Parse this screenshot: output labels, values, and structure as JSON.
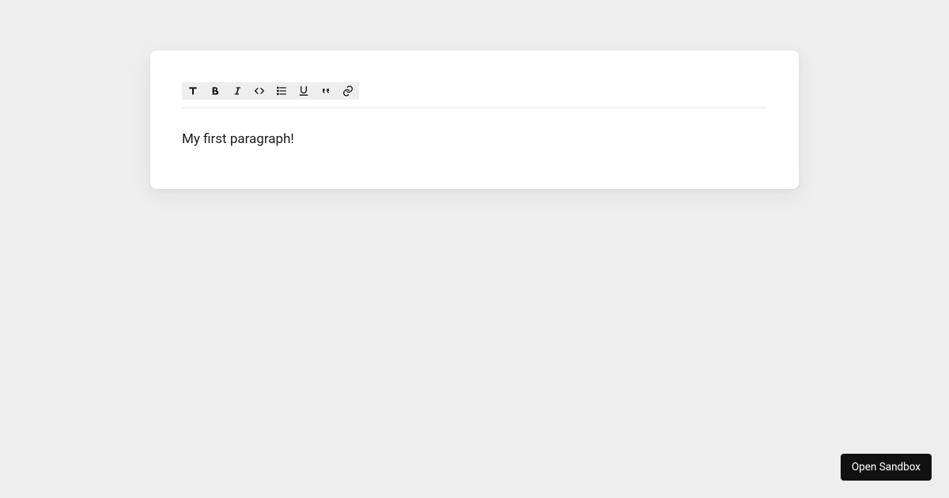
{
  "toolbar": {
    "text_label": "T",
    "bold_label": "B",
    "italic_label": "I"
  },
  "editor": {
    "content": "My first paragraph!"
  },
  "footer": {
    "open_sandbox_label": "Open Sandbox"
  }
}
